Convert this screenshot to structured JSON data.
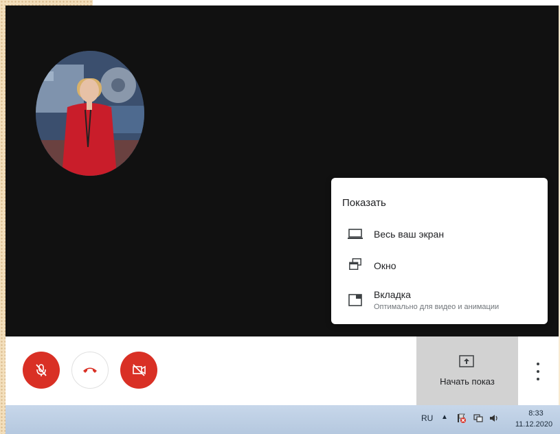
{
  "share_menu": {
    "title": "Показать",
    "items": [
      {
        "label": "Весь ваш экран",
        "icon": "monitor-icon"
      },
      {
        "label": "Окно",
        "icon": "window-icon"
      },
      {
        "label": "Вкладка",
        "sublabel": "Оптимально для видео и анимации",
        "icon": "tab-icon"
      }
    ]
  },
  "controls": {
    "mic_icon": "mic-off-icon",
    "hangup_icon": "phone-hangup-icon",
    "camera_icon": "camera-off-icon",
    "present_label": "Начать показ",
    "present_icon": "present-upload-icon",
    "more_icon": "more-vert-icon"
  },
  "taskbar": {
    "language": "RU",
    "time": "8:33",
    "date": "11.12.2020"
  },
  "colors": {
    "stage": "#111111",
    "danger": "#d93025",
    "present_bg": "#d2d2d2",
    "taskbar": "#c0d1e6"
  }
}
